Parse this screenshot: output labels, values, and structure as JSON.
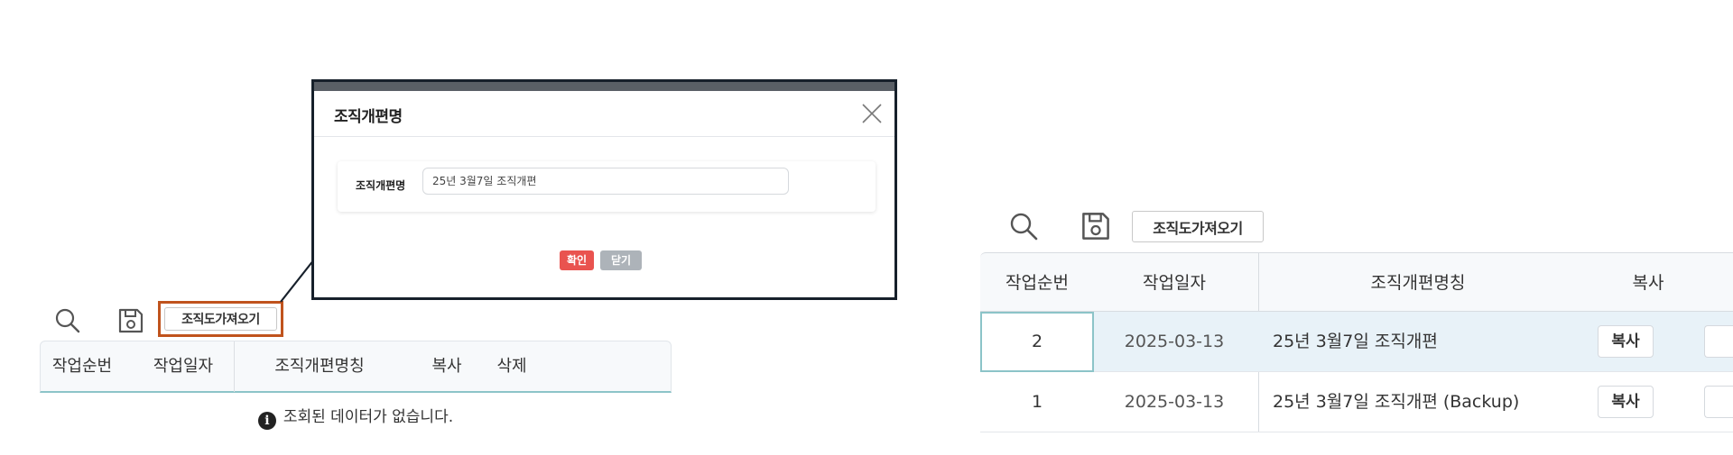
{
  "left_panel": {
    "toolbar": {
      "search_icon": "search-icon",
      "save_icon": "save-icon",
      "import_button": "조직도가져오기"
    },
    "table": {
      "headers": [
        "작업순번",
        "작업일자",
        "조직개편명칭",
        "복사",
        "삭제"
      ],
      "empty_message": "조회된 데이터가 없습니다.",
      "info_glyph": "i"
    },
    "highlight_color": "#c0531d"
  },
  "popup": {
    "title": "조직개편명",
    "close_icon": "close-icon",
    "form": {
      "label": "조직개편명",
      "value": "25년 3월7일 조직개편"
    },
    "buttons": {
      "confirm": "확인",
      "close": "닫기"
    },
    "colors": {
      "confirm": "#e9534f",
      "close": "#adb3b9",
      "border": "#17202b"
    }
  },
  "right_panel": {
    "toolbar": {
      "search_icon": "search-icon",
      "save_icon": "save-icon",
      "import_button": "조직도가져오기"
    },
    "table": {
      "headers": [
        "작업순번",
        "작업일자",
        "조직개편명칭",
        "복사"
      ],
      "rows": [
        {
          "seq": "2",
          "date": "2025-03-13",
          "name": "25년 3월7일 조직개편",
          "copy": "복사",
          "selected": true
        },
        {
          "seq": "1",
          "date": "2025-03-13",
          "name": "25년 3월7일 조직개편 (Backup)",
          "copy": "복사",
          "selected": false
        }
      ]
    },
    "colors": {
      "selected_row": "#e8f2f8",
      "accent_border": "#8cc4c8"
    }
  }
}
